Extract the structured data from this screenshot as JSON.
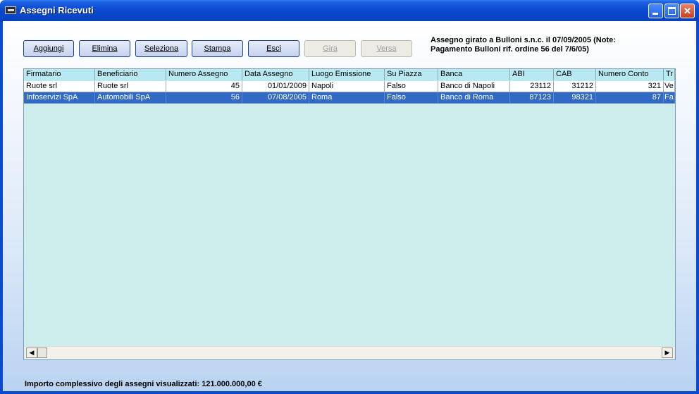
{
  "window": {
    "title": "Assegni Ricevuti"
  },
  "toolbar": {
    "buttons": [
      {
        "label": "Aggiungi",
        "enabled": true
      },
      {
        "label": "Elimina",
        "enabled": true
      },
      {
        "label": "Seleziona",
        "enabled": true
      },
      {
        "label": "Stampa",
        "enabled": true
      },
      {
        "label": "Esci",
        "enabled": true
      },
      {
        "label": "Gira",
        "enabled": false
      },
      {
        "label": "Versa",
        "enabled": false
      }
    ]
  },
  "note": {
    "line1": "Assegno girato a Bulloni s.n.c.  il 07/09/2005 (Note:",
    "line2": "Pagamento Bulloni rif. ordine 56 del 7/6/05)"
  },
  "grid": {
    "columns": [
      "Firmatario",
      "Beneficiario",
      "Numero Assegno",
      "Data Assegno",
      "Luogo Emissione",
      "Su Piazza",
      "Banca",
      "ABI",
      "CAB",
      "Numero Conto",
      "Tr"
    ],
    "rows": [
      [
        "Ruote srl",
        "Ruote srl",
        "45",
        "01/01/2009",
        "Napoli",
        "Falso",
        "Banco di Napoli",
        "23112",
        "31212",
        "321",
        "Ve"
      ],
      [
        "Infoservizi SpA",
        "Automobili SpA",
        "56",
        "07/08/2005",
        "Roma",
        "Falso",
        "Banco di Roma",
        "87123",
        "98321",
        "87",
        "Fa"
      ]
    ],
    "selected_row": 1
  },
  "status": {
    "text": "Importo complessivo degli assegni visualizzati: 121.000.000,00 €"
  },
  "colors": {
    "title_bar": "#0a4ad0",
    "grid_bg": "#cdeeed",
    "header_bg": "#b8e8f1",
    "selection": "#316ac5"
  }
}
